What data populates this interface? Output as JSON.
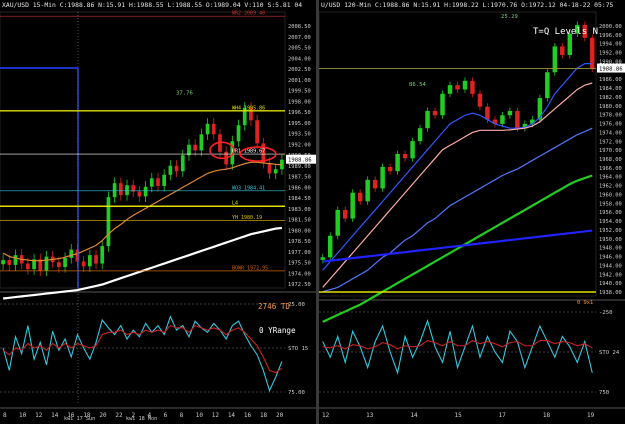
{
  "left": {
    "header": "XAU/USD  15-Min  C:1988.86  N:15.91  H:1988.55  L:1988.55  O:1989.04  V:110  S:5.81  04-18-22  12:56",
    "current_price_label": "1988.86",
    "price_ticks": [
      "2008.50",
      "2007.00",
      "2005.50",
      "2004.00",
      "2002.50",
      "2001.00",
      "1999.50",
      "1998.00",
      "1996.50",
      "1995.00",
      "1993.50",
      "1992.00",
      "1990.50",
      "1989.00",
      "1987.50",
      "1986.00",
      "1984.50",
      "1983.00",
      "1981.50",
      "1980.00",
      "1978.50",
      "1977.00",
      "1975.50",
      "1974.00",
      "1972.50"
    ],
    "levels": [
      {
        "label": "WR2  2009.40",
        "value": 2009.4,
        "color": "#cc3333"
      },
      {
        "label": "WH4  1995.86",
        "value": 1995.86,
        "color": "#e0e000"
      },
      {
        "label": "WR1  1989.67",
        "value": 1989.67,
        "color": "#ffffff"
      },
      {
        "label": "WO3  1984.41",
        "value": 1984.41,
        "color": "#33c8e0"
      },
      {
        "label": "L4",
        "value": 1982.2,
        "color": "#e0e000"
      },
      {
        "label": "YH  1980.19",
        "value": 1980.19,
        "color": "#e0c000"
      },
      {
        "label": "BOWR  1972.95",
        "value": 1972.95,
        "color": "#cc6600"
      }
    ],
    "annotations": [
      "37.76",
      "2746  TD",
      "0 YRange"
    ],
    "osc_ticks": [
      "25.00",
      "STO  15",
      "75.00"
    ],
    "x_ticks": [
      "8",
      "10",
      "12",
      "14",
      "16",
      "18",
      "20",
      "22",
      "2",
      "4",
      "6",
      "8",
      "10",
      "12",
      "14",
      "16",
      "18",
      "20"
    ],
    "x_sub": [
      "kwi 17 Sun",
      "kwi 18 Mon"
    ]
  },
  "right": {
    "header": "U/USD  120-Min  C:1988.86  N:15.91  H:1998.22  L:1970.76  O:1972.12  04-18-22  05:75",
    "title": "T=Q Levels N",
    "current_price_label": "1988.86",
    "price_ticks": [
      "2000.00",
      "1996.00",
      "1994.00",
      "1992.00",
      "1990.00",
      "1988.00",
      "1986.00",
      "1984.00",
      "1982.00",
      "1980.00",
      "1978.00",
      "1976.00",
      "1974.00",
      "1972.00",
      "1970.00",
      "1968.00",
      "1966.00",
      "1964.00",
      "1962.00",
      "1960.00",
      "1958.00",
      "1956.00",
      "1954.00",
      "1952.00",
      "1950.00",
      "1948.00",
      "1946.00",
      "1944.00",
      "1942.00",
      "1940.00",
      "1938.00"
    ],
    "annotations": [
      "25.29",
      "86.54",
      "0 9x1"
    ],
    "osc_ticks": [
      "-250",
      "STO  24",
      "750"
    ],
    "x_ticks": [
      "12",
      "13",
      "14",
      "15",
      "17",
      "18",
      "19"
    ]
  },
  "chart_data": [
    {
      "type": "line",
      "title": "XAU/USD 15-Min",
      "ylim": [
        1970.5,
        2010.0
      ],
      "series": [
        {
          "name": "close",
          "color": "#22cc22",
          "values": [
            1974.5,
            1973.8,
            1975.2,
            1974.0,
            1973.2,
            1974.6,
            1973.0,
            1975.0,
            1974.2,
            1973.5,
            1974.8,
            1976.0,
            1974.3,
            1973.6,
            1975.2,
            1974.0,
            1976.5,
            1983.5,
            1985.5,
            1983.8,
            1985.2,
            1984.3,
            1983.6,
            1985.0,
            1986.2,
            1985.1,
            1986.7,
            1988.0,
            1987.2,
            1989.5,
            1991.0,
            1990.2,
            1992.5,
            1994.0,
            1992.5,
            1990.0,
            1988.2,
            1991.5,
            1993.8,
            1996.3,
            1994.5,
            1991.2,
            1988.4,
            1986.9,
            1987.5,
            1988.86
          ]
        },
        {
          "name": "ma_fast",
          "color": "#e08830",
          "values": [
            1975.5,
            1975.0,
            1974.8,
            1974.6,
            1974.5,
            1974.4,
            1974.4,
            1974.5,
            1974.6,
            1974.7,
            1974.9,
            1975.2,
            1975.4,
            1975.8,
            1976.2,
            1976.6,
            1977.3,
            1978.2,
            1979.0,
            1979.6,
            1980.3,
            1980.9,
            1981.4,
            1981.9,
            1982.4,
            1982.9,
            1983.4,
            1983.9,
            1984.4,
            1984.9,
            1985.4,
            1985.9,
            1986.4,
            1986.9,
            1987.2,
            1987.4,
            1987.5,
            1987.7,
            1988.0,
            1988.3,
            1988.5,
            1988.5,
            1988.4,
            1988.3,
            1988.2,
            1988.1
          ]
        },
        {
          "name": "ma_slow",
          "color": "#ffffff",
          "values": [
            1969.0,
            1969.1,
            1969.2,
            1969.3,
            1969.4,
            1969.5,
            1969.6,
            1969.7,
            1969.8,
            1969.9,
            1970.0,
            1970.1,
            1970.2,
            1970.4,
            1970.6,
            1970.8,
            1971.0,
            1971.3,
            1971.6,
            1971.9,
            1972.2,
            1972.5,
            1972.8,
            1973.1,
            1973.4,
            1973.7,
            1974.0,
            1974.3,
            1974.6,
            1974.9,
            1975.2,
            1975.5,
            1975.8,
            1976.1,
            1976.4,
            1976.7,
            1977.0,
            1977.3,
            1977.6,
            1977.9,
            1978.2,
            1978.4,
            1978.6,
            1978.8,
            1979.0,
            1979.1
          ]
        }
      ],
      "osc": {
        "ylim": [
          0,
          100
        ],
        "series": [
          {
            "name": "fast",
            "color": "#33c8e0",
            "values": [
              50,
              30,
              60,
              45,
              70,
              40,
              55,
              35,
              65,
              48,
              58,
              42,
              62,
              50,
              40,
              55,
              75,
              68,
              62,
              70,
              58,
              66,
              60,
              72,
              64,
              70,
              62,
              78,
              66,
              70,
              60,
              74,
              68,
              64,
              72,
              66,
              58,
              70,
              74,
              62,
              52,
              44,
              30,
              12,
              24,
              38
            ]
          },
          {
            "name": "slow",
            "color": "#cc2222",
            "values": [
              48,
              44,
              50,
              48,
              54,
              50,
              52,
              48,
              54,
              50,
              54,
              50,
              54,
              52,
              50,
              52,
              62,
              64,
              64,
              66,
              62,
              64,
              62,
              66,
              64,
              66,
              64,
              70,
              68,
              68,
              64,
              70,
              68,
              66,
              68,
              66,
              62,
              66,
              68,
              64,
              58,
              52,
              42,
              30,
              28,
              32
            ]
          }
        ]
      }
    },
    {
      "type": "line",
      "title": "T=Q Levels N",
      "ylim": [
        1936.0,
        2002.0
      ],
      "series": [
        {
          "name": "close",
          "color": "#22cc22",
          "values": [
            1945,
            1950,
            1956,
            1954,
            1960,
            1958,
            1963,
            1961,
            1966,
            1965,
            1969,
            1968,
            1972,
            1975,
            1979,
            1978,
            1983,
            1985,
            1984,
            1986,
            1983,
            1980,
            1977,
            1976,
            1978,
            1979,
            1975,
            1976,
            1977,
            1982,
            1988,
            1994,
            1992,
            1997,
            1999,
            1996,
            1988.86
          ]
        },
        {
          "name": "ma1",
          "color": "#3355ff",
          "values": [
            1942,
            1944,
            1946,
            1948,
            1950,
            1952,
            1954,
            1956,
            1958,
            1960,
            1962,
            1964,
            1966,
            1968,
            1970,
            1972,
            1974,
            1976,
            1977,
            1978,
            1978.5,
            1978,
            1977,
            1976,
            1975.5,
            1975,
            1975,
            1975.2,
            1976,
            1977.5,
            1980,
            1983,
            1985,
            1987,
            1989,
            1990,
            1990
          ]
        },
        {
          "name": "ma2",
          "color": "#ffaaaa",
          "values": [
            1938,
            1940,
            1942,
            1944,
            1946,
            1948,
            1950,
            1952,
            1954,
            1956,
            1958,
            1960,
            1962,
            1964,
            1966,
            1968,
            1970,
            1971,
            1972,
            1973,
            1974,
            1974.5,
            1974.5,
            1974.5,
            1974.5,
            1974.6,
            1974.8,
            1975,
            1975.5,
            1976.5,
            1978,
            1979.5,
            1981,
            1982.5,
            1984,
            1985,
            1985.5
          ]
        },
        {
          "name": "ma3",
          "color": "#5577ff",
          "values": [
            1937,
            1937.5,
            1938,
            1939,
            1940,
            1941,
            1942,
            1943.5,
            1945,
            1946,
            1947.5,
            1949,
            1950,
            1951.5,
            1953,
            1954,
            1955.5,
            1957,
            1958,
            1959,
            1960,
            1961,
            1962,
            1963,
            1964,
            1964.8,
            1965.5,
            1966.5,
            1967.5,
            1968.5,
            1969.5,
            1970.5,
            1971.5,
            1972.5,
            1973.5,
            1974.2,
            1975
          ]
        },
        {
          "name": "ma4",
          "color": "#22cc22",
          "values": [
            1930,
            1930.8,
            1931.6,
            1932.4,
            1933.2,
            1934,
            1935,
            1936,
            1937,
            1938,
            1939,
            1940,
            1941,
            1942,
            1943,
            1944,
            1945,
            1946,
            1947,
            1948,
            1949,
            1950,
            1951,
            1952,
            1953,
            1954,
            1955,
            1956,
            1957,
            1958,
            1959,
            1960,
            1961,
            1962,
            1962.8,
            1963.4,
            1964
          ]
        },
        {
          "name": "ma5",
          "color": "#2222ff",
          "values": [
            1944,
            1944.2,
            1944.4,
            1944.6,
            1944.8,
            1945,
            1945.2,
            1945.4,
            1945.6,
            1945.8,
            1946,
            1946.2,
            1946.4,
            1946.6,
            1946.8,
            1947,
            1947.2,
            1947.4,
            1947.6,
            1947.8,
            1948,
            1948.2,
            1948.4,
            1948.6,
            1948.8,
            1949,
            1949.2,
            1949.4,
            1949.6,
            1949.8,
            1950,
            1950.2,
            1950.4,
            1950.6,
            1950.8,
            1951,
            1951.2
          ]
        }
      ],
      "osc": {
        "ylim": [
          -1000,
          1000
        ],
        "series": [
          {
            "name": "fast",
            "color": "#33c8e0",
            "values": [
              200,
              -100,
              300,
              -200,
              400,
              100,
              -300,
              200,
              500,
              0,
              -400,
              300,
              -100,
              200,
              600,
              100,
              -200,
              400,
              -300,
              100,
              500,
              -100,
              300,
              0,
              -200,
              400,
              200,
              -300,
              100,
              500,
              200,
              -100,
              300,
              100,
              -200,
              200,
              -400
            ]
          },
          {
            "name": "slow",
            "color": "#cc2222",
            "values": [
              100,
              80,
              120,
              60,
              140,
              120,
              60,
              100,
              180,
              140,
              60,
              120,
              100,
              120,
              220,
              180,
              120,
              200,
              120,
              120,
              220,
              160,
              200,
              160,
              100,
              180,
              200,
              120,
              120,
              220,
              220,
              160,
              200,
              180,
              120,
              160,
              80
            ]
          }
        ]
      }
    }
  ]
}
